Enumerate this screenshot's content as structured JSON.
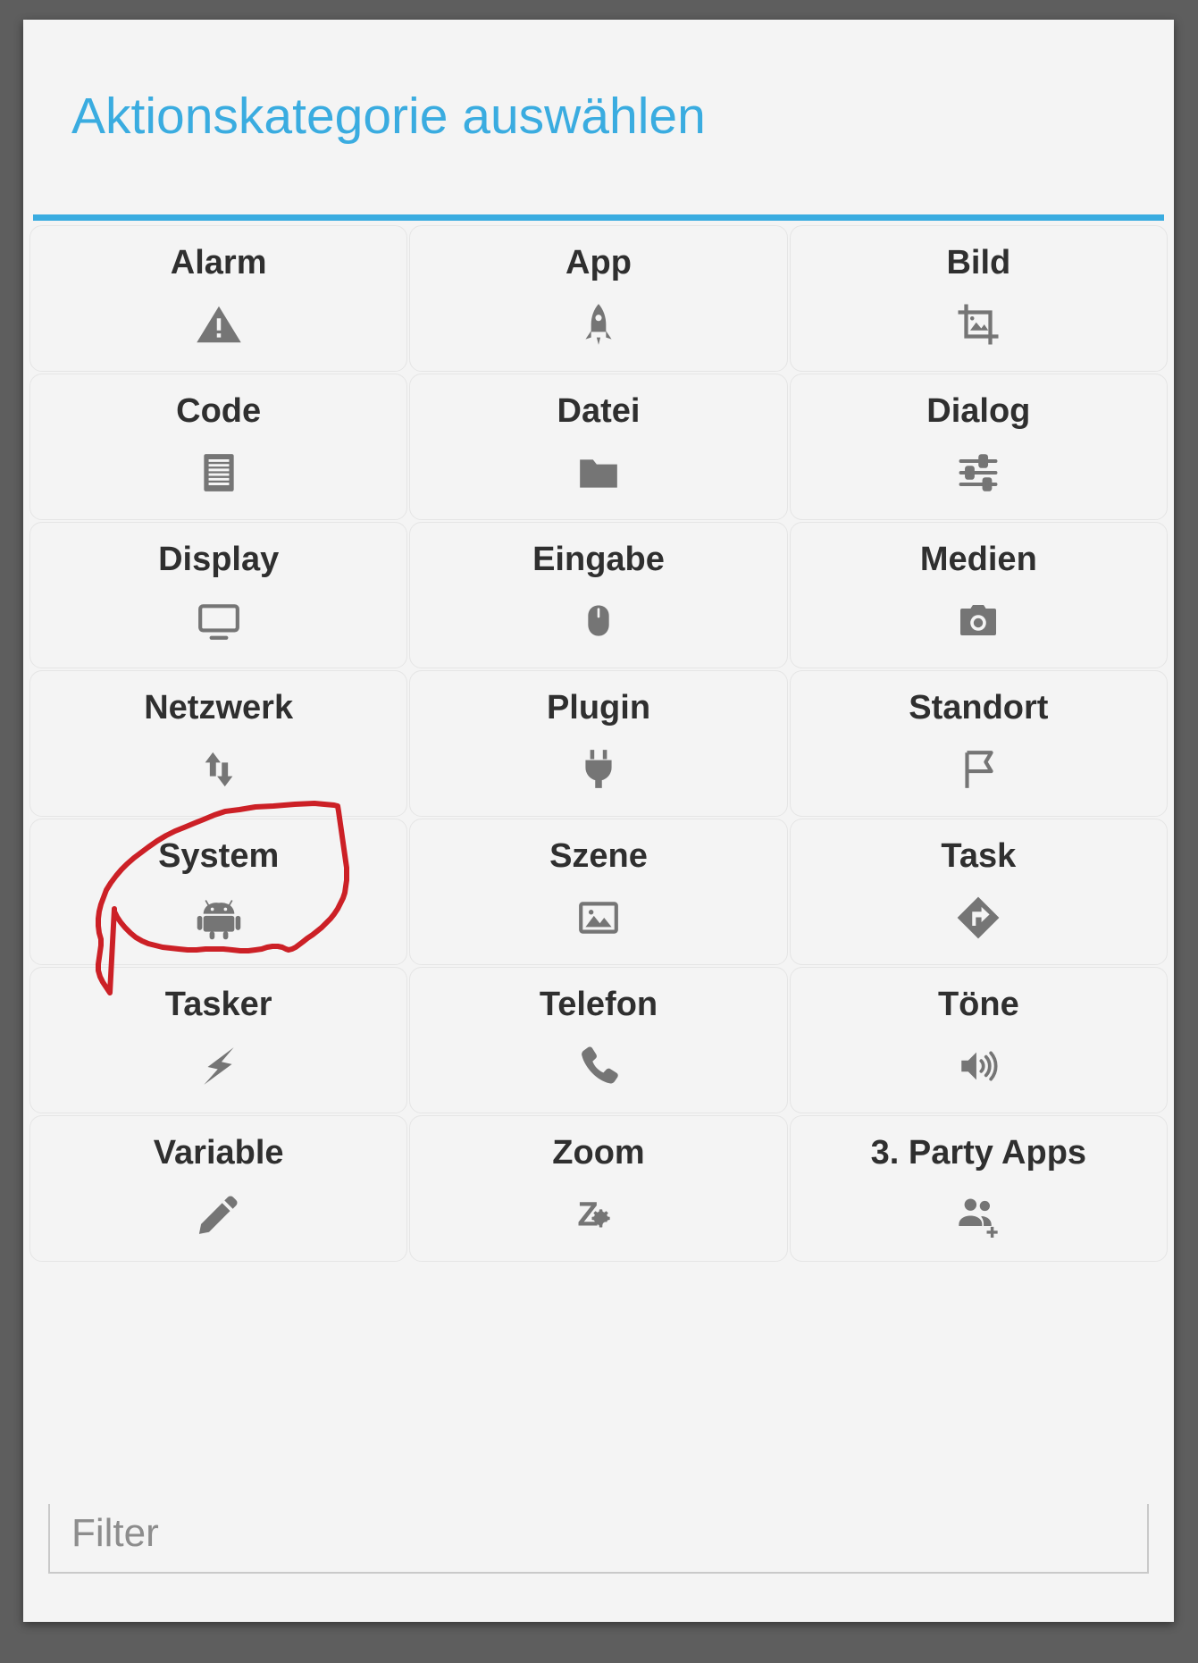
{
  "dialog": {
    "title": "Aktionskategorie auswählen",
    "accent_color": "#3aace0",
    "background_color": "#f4f4f4",
    "scrim_color": "#5e5e5e"
  },
  "grid": {
    "columns": 3,
    "items": [
      {
        "label": "Alarm",
        "icon": "warning-triangle-icon"
      },
      {
        "label": "App",
        "icon": "rocket-icon"
      },
      {
        "label": "Bild",
        "icon": "image-crop-icon"
      },
      {
        "label": "Code",
        "icon": "document-lines-icon"
      },
      {
        "label": "Datei",
        "icon": "folder-icon"
      },
      {
        "label": "Dialog",
        "icon": "sliders-icon"
      },
      {
        "label": "Display",
        "icon": "monitor-icon"
      },
      {
        "label": "Eingabe",
        "icon": "mouse-icon"
      },
      {
        "label": "Medien",
        "icon": "camera-icon"
      },
      {
        "label": "Netzwerk",
        "icon": "up-down-arrows-icon"
      },
      {
        "label": "Plugin",
        "icon": "power-plug-icon"
      },
      {
        "label": "Standort",
        "icon": "flag-icon"
      },
      {
        "label": "System",
        "icon": "android-robot-icon"
      },
      {
        "label": "Szene",
        "icon": "picture-icon"
      },
      {
        "label": "Task",
        "icon": "arrow-diamond-icon"
      },
      {
        "label": "Tasker",
        "icon": "lightning-bolt-icon"
      },
      {
        "label": "Telefon",
        "icon": "phone-handset-icon"
      },
      {
        "label": "Töne",
        "icon": "speaker-volume-icon"
      },
      {
        "label": "Variable",
        "icon": "pencil-icon"
      },
      {
        "label": "Zoom",
        "icon": "z-gear-icon"
      },
      {
        "label": "3. Party Apps",
        "icon": "group-add-icon"
      }
    ]
  },
  "filter": {
    "placeholder": "Filter",
    "value": ""
  },
  "annotation": {
    "name": "red-circle-around-system",
    "color": "#cc2026",
    "target_label": "System"
  }
}
